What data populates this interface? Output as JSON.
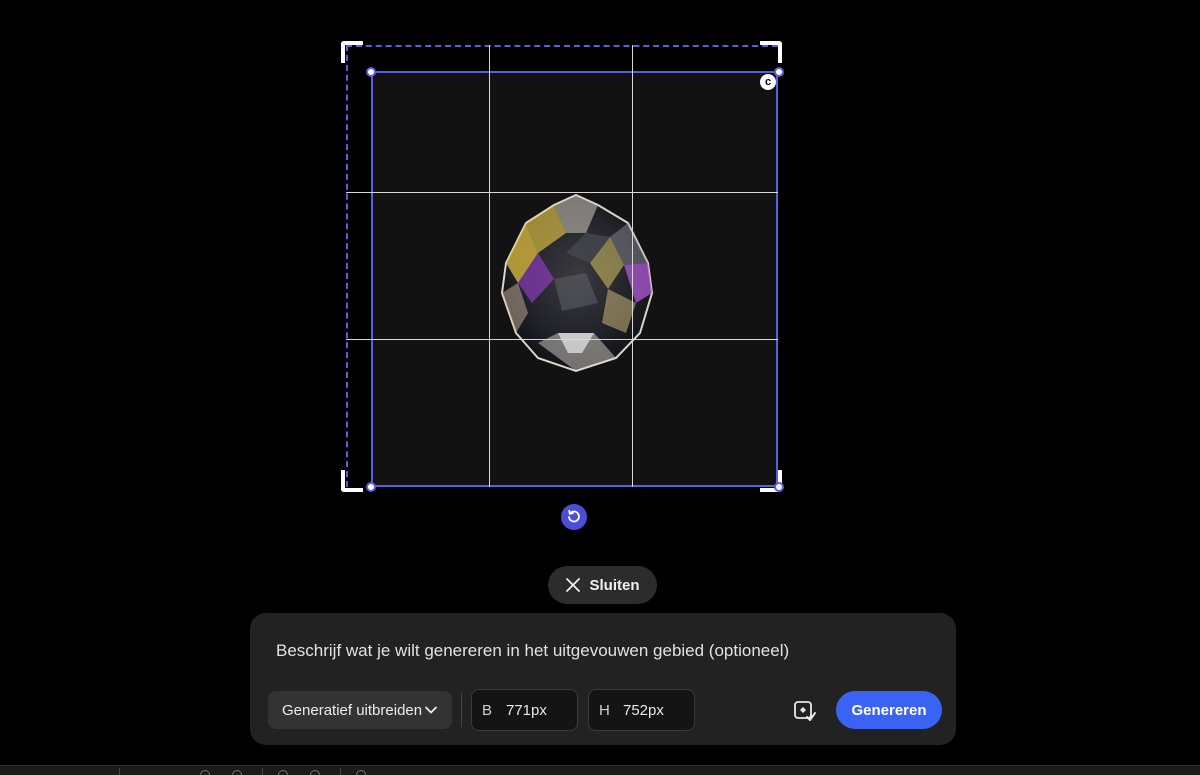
{
  "canvas": {
    "accent_color": "#5a5fe0",
    "ratio_lock_glyph": "c",
    "reset_icon": "rotate-ccw-icon"
  },
  "close_button": {
    "label": "Sluiten",
    "icon": "close-icon"
  },
  "prompt_panel": {
    "placeholder": "Beschrijf wat je wilt genereren in het uitgevouwen gebied (optioneel)",
    "mode_dropdown": {
      "selected": "Generatief uitbreiden",
      "icon": "chevron-down-icon"
    },
    "width_field": {
      "label": "B",
      "value": "771px"
    },
    "height_field": {
      "label": "H",
      "value": "752px"
    },
    "content_credentials_icon": "content-credentials-icon",
    "generate_button": {
      "label": "Genereren",
      "color": "#3b63f3"
    }
  }
}
